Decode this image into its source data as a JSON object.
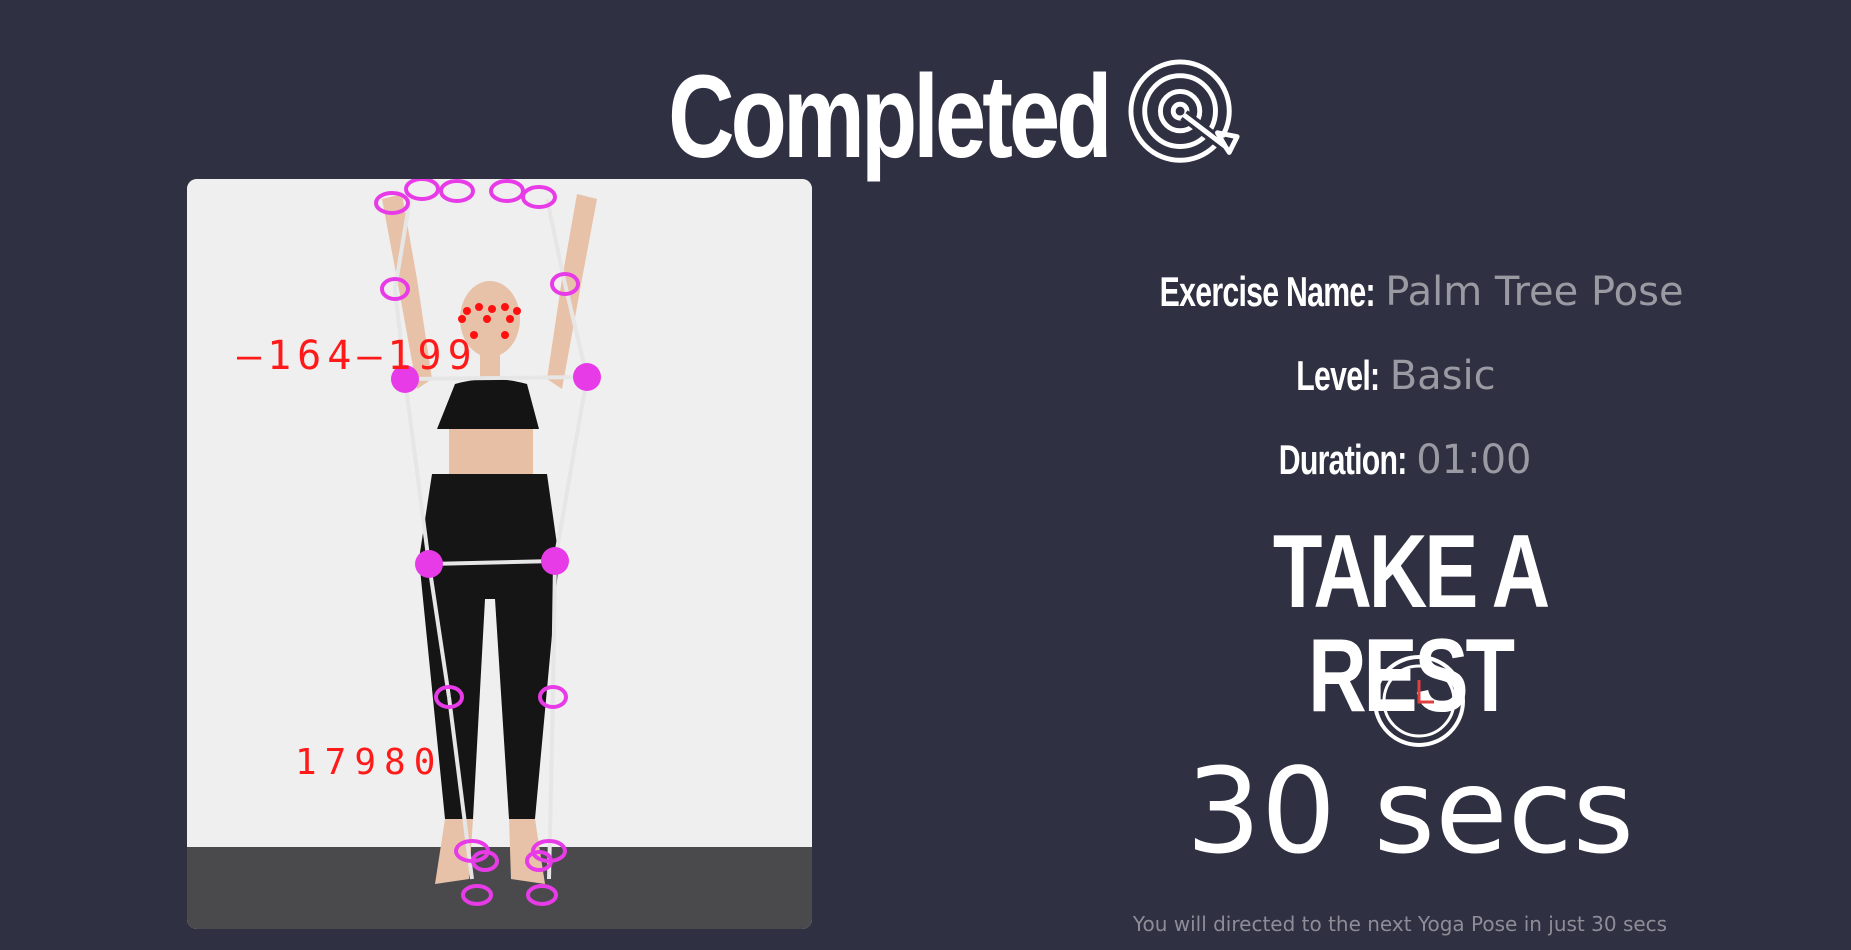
{
  "header": {
    "title": "Completed",
    "icon": "target-icon"
  },
  "pose_image": {
    "overlay_labels": [
      "—164—199",
      "17980"
    ],
    "colors": {
      "keypoint": "#e83be8",
      "face_point": "#ff1010",
      "skeleton": "#e6e6e6",
      "label": "#ff1a1a"
    }
  },
  "details": {
    "exercise_label": "Exercise Name:",
    "exercise_value": "Palm Tree Pose",
    "level_label": "Level:",
    "level_value": "Basic",
    "duration_label": "Duration:",
    "duration_value": "01:00"
  },
  "rest": {
    "heading": "TAKE A REST",
    "icon": "clock-icon",
    "countdown": "30 secs",
    "note": "You will directed to the next Yoga Pose in just 30 secs"
  },
  "colors": {
    "background": "#2f3042",
    "muted_text": "#9a9aa2"
  }
}
